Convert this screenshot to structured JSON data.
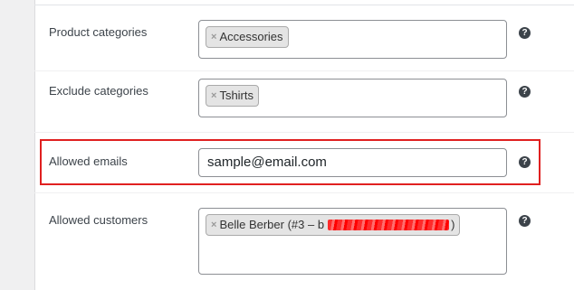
{
  "rows": {
    "product_categories": {
      "label": "Product categories",
      "chip": "Accessories",
      "remove_symbol": "×"
    },
    "exclude_categories": {
      "label": "Exclude categories",
      "chip": "Tshirts",
      "remove_symbol": "×"
    },
    "allowed_emails": {
      "label": "Allowed emails",
      "value": "sample@email.com"
    },
    "allowed_customers": {
      "label": "Allowed customers",
      "chip_prefix": "Belle Berber (#3 – b",
      "chip_suffix": ")",
      "remove_symbol": "×"
    }
  },
  "help_symbol": "?",
  "colors": {
    "highlight": "#e02020",
    "help_icon_bg": "#3c434a",
    "chip_bg": "#e4e4e4"
  }
}
